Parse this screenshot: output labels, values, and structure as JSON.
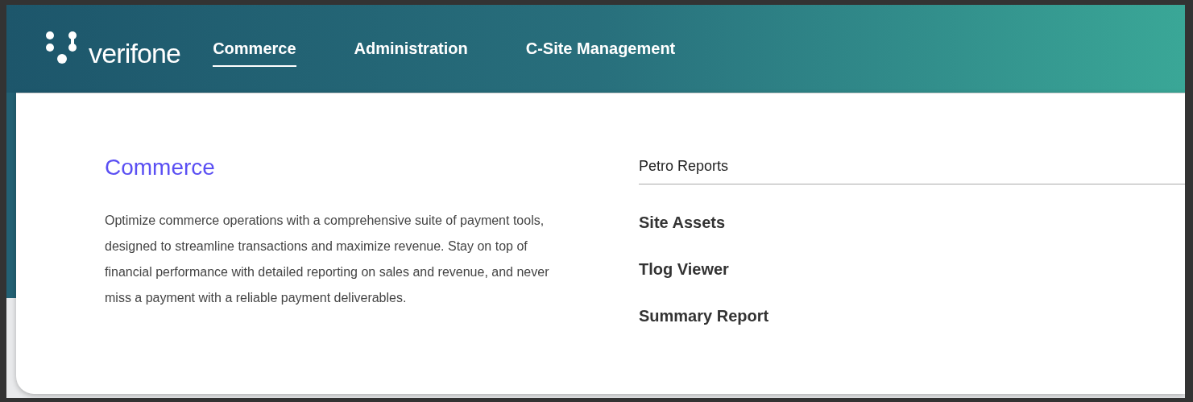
{
  "brand": {
    "name": "verifone"
  },
  "nav": [
    {
      "label": "Commerce",
      "selected": true
    },
    {
      "label": "Administration",
      "selected": false
    },
    {
      "label": "C-Site Management",
      "selected": false
    }
  ],
  "menu": {
    "title": "Commerce",
    "description": "Optimize commerce operations with a comprehensive suite of payment tools, designed to streamline transactions and maximize revenue. Stay on top of financial performance with detailed reporting on sales and revenue, and never miss a payment with a reliable payment deliverables.",
    "section": "Petro Reports",
    "links": [
      "Site Assets",
      "Tlog Viewer",
      "Summary Report"
    ]
  }
}
